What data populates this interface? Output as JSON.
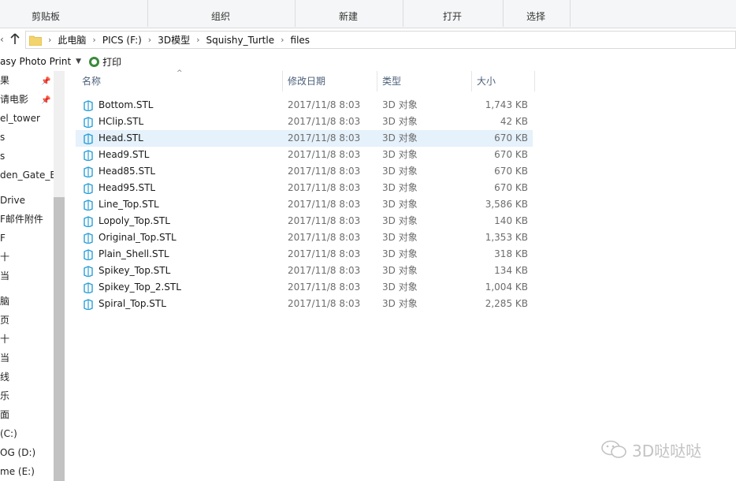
{
  "ribbon": {
    "groups": [
      {
        "label": "剪贴板"
      },
      {
        "label": "组织"
      },
      {
        "label": "新建"
      },
      {
        "label": "打开"
      },
      {
        "label": "选择"
      }
    ]
  },
  "address": {
    "crumbs": [
      "此电脑",
      "PICS (F:)",
      "3D模型",
      "Squishy_Turtle",
      "files"
    ]
  },
  "commands": {
    "app_label": "asy Photo Print",
    "print_label": "打印"
  },
  "navpane": {
    "items": [
      "果",
      "请电影",
      "el_tower",
      "s",
      "s",
      "den_Gate_B",
      "Drive",
      "F邮件附件",
      "F",
      "十",
      "当",
      "脑",
      "页",
      "十",
      "当",
      "线",
      "乐",
      "面",
      "(C:)",
      "OG (D:)",
      "me (E:)"
    ]
  },
  "columns": {
    "name": "名称",
    "modified": "修改日期",
    "type": "类型",
    "size": "大小"
  },
  "files": [
    {
      "name": "Bottom.STL",
      "modified": "2017/11/8 8:03",
      "type": "3D 对象",
      "size": "1,743 KB"
    },
    {
      "name": "HClip.STL",
      "modified": "2017/11/8 8:03",
      "type": "3D 对象",
      "size": "42 KB"
    },
    {
      "name": "Head.STL",
      "modified": "2017/11/8 8:03",
      "type": "3D 对象",
      "size": "670 KB"
    },
    {
      "name": "Head9.STL",
      "modified": "2017/11/8 8:03",
      "type": "3D 对象",
      "size": "670 KB"
    },
    {
      "name": "Head85.STL",
      "modified": "2017/11/8 8:03",
      "type": "3D 对象",
      "size": "670 KB"
    },
    {
      "name": "Head95.STL",
      "modified": "2017/11/8 8:03",
      "type": "3D 对象",
      "size": "670 KB"
    },
    {
      "name": "Line_Top.STL",
      "modified": "2017/11/8 8:03",
      "type": "3D 对象",
      "size": "3,586 KB"
    },
    {
      "name": "Lopoly_Top.STL",
      "modified": "2017/11/8 8:03",
      "type": "3D 对象",
      "size": "140 KB"
    },
    {
      "name": "Original_Top.STL",
      "modified": "2017/11/8 8:03",
      "type": "3D 对象",
      "size": "1,353 KB"
    },
    {
      "name": "Plain_Shell.STL",
      "modified": "2017/11/8 8:03",
      "type": "3D 对象",
      "size": "318 KB"
    },
    {
      "name": "Spikey_Top.STL",
      "modified": "2017/11/8 8:03",
      "type": "3D 对象",
      "size": "134 KB"
    },
    {
      "name": "Spikey_Top_2.STL",
      "modified": "2017/11/8 8:03",
      "type": "3D 对象",
      "size": "1,004 KB"
    },
    {
      "name": "Spiral_Top.STL",
      "modified": "2017/11/8 8:03",
      "type": "3D 对象",
      "size": "2,285 KB"
    }
  ],
  "selected_file": "Head.STL",
  "watermark": {
    "text": "3D哒哒哒"
  },
  "colors": {
    "selection": "#e5f1fb",
    "header_text": "#4c607a",
    "stl_icon": "#2a9fd8"
  }
}
